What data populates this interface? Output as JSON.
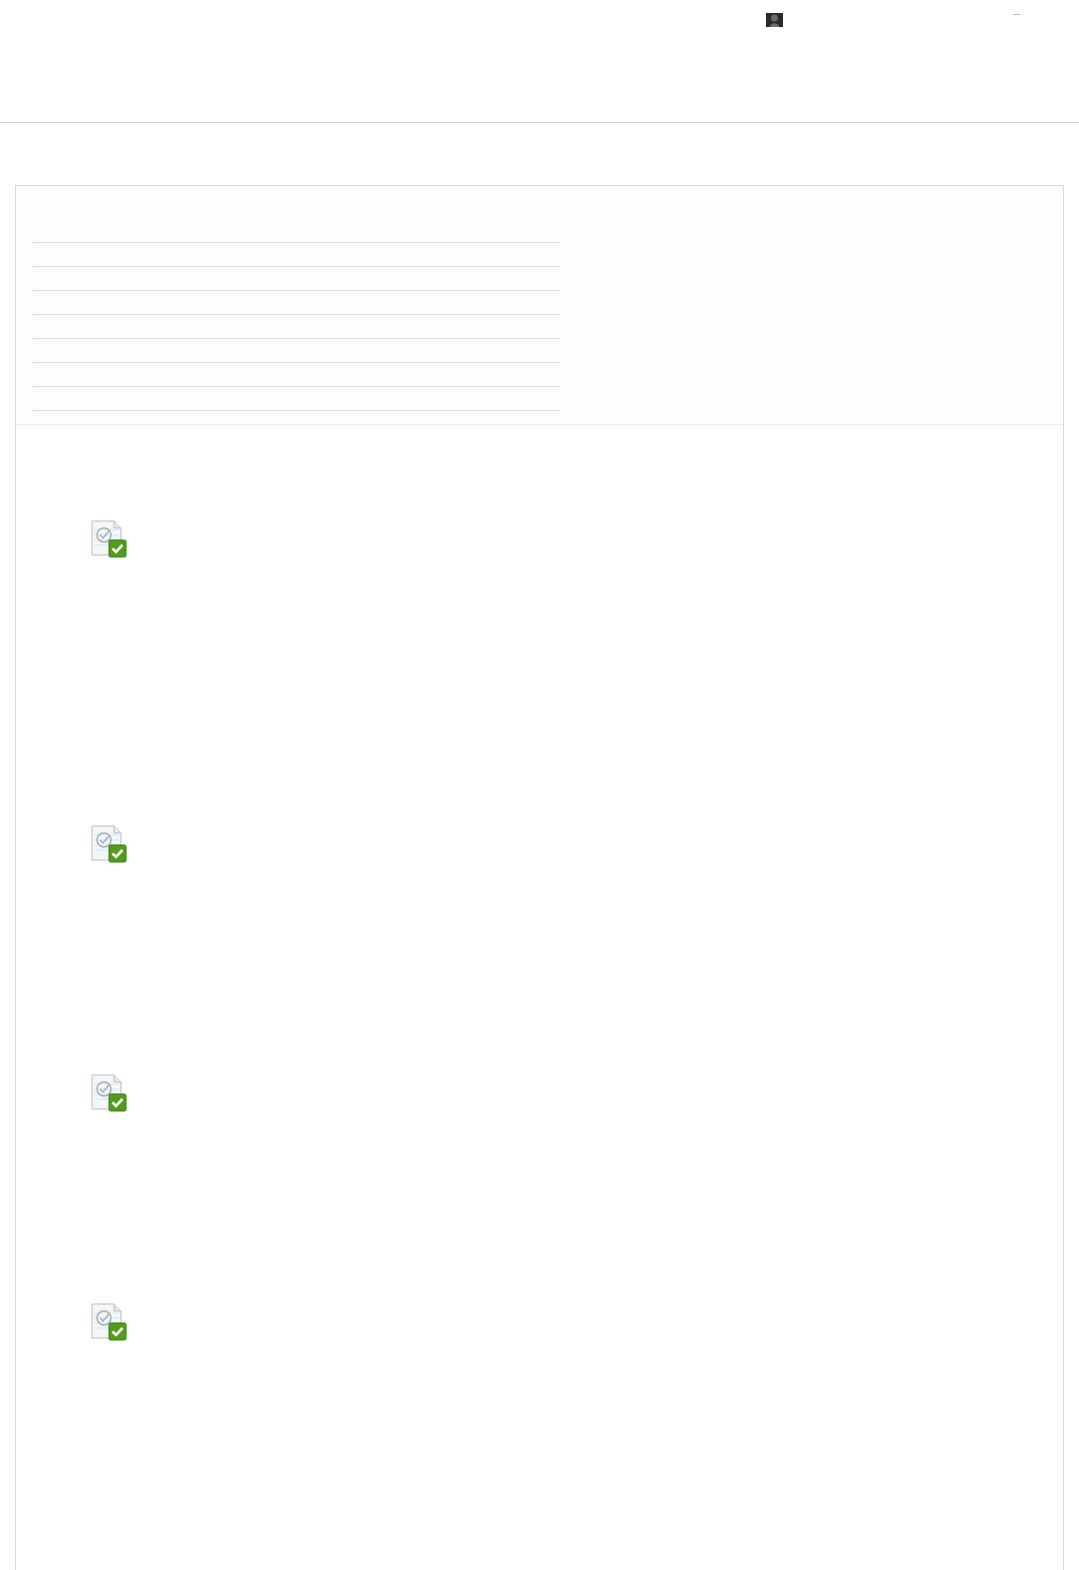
{
  "header": {
    "user": {
      "kind": "avatar"
    },
    "menu": {
      "kind": "dash"
    }
  },
  "summary": {
    "rows": [
      {
        "kind": "dotted"
      },
      {
        "kind": "dotted"
      },
      {
        "kind": "dotted"
      },
      {
        "kind": "dotted"
      },
      {
        "kind": "dotted"
      },
      {
        "kind": "dotted"
      },
      {
        "kind": "dotted"
      },
      {
        "kind": "dotted"
      }
    ]
  },
  "tasks": [
    {
      "kind": "task"
    },
    {
      "kind": "task"
    },
    {
      "kind": "task"
    },
    {
      "kind": "task"
    }
  ]
}
